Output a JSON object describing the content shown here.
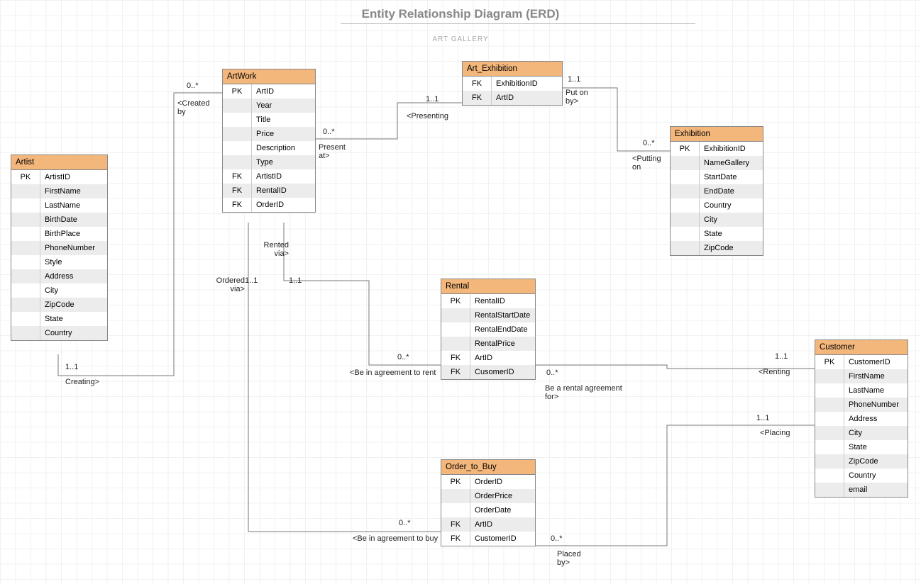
{
  "title": "Entity Relationship Diagram (ERD)",
  "subtitle": "ART GALLERY",
  "entities": {
    "artist": {
      "name": "Artist",
      "rows": [
        {
          "k": "PK",
          "f": "ArtistID"
        },
        {
          "k": "",
          "f": "FirstName"
        },
        {
          "k": "",
          "f": "LastName"
        },
        {
          "k": "",
          "f": "BirthDate"
        },
        {
          "k": "",
          "f": "BirthPlace"
        },
        {
          "k": "",
          "f": "PhoneNumber"
        },
        {
          "k": "",
          "f": "Style"
        },
        {
          "k": "",
          "f": "Address"
        },
        {
          "k": "",
          "f": "City"
        },
        {
          "k": "",
          "f": "ZipCode"
        },
        {
          "k": "",
          "f": "State"
        },
        {
          "k": "",
          "f": "Country"
        }
      ]
    },
    "artwork": {
      "name": "ArtWork",
      "rows": [
        {
          "k": "PK",
          "f": "ArtID"
        },
        {
          "k": "",
          "f": "Year"
        },
        {
          "k": "",
          "f": "Title"
        },
        {
          "k": "",
          "f": "Price"
        },
        {
          "k": "",
          "f": "Description"
        },
        {
          "k": "",
          "f": "Type"
        },
        {
          "k": "FK",
          "f": "ArtistID"
        },
        {
          "k": "FK",
          "f": "RentalID"
        },
        {
          "k": "FK",
          "f": "OrderID"
        }
      ]
    },
    "art_exhibition": {
      "name": "Art_Exhibition",
      "rows": [
        {
          "k": "FK",
          "f": "ExhibitionID"
        },
        {
          "k": "FK",
          "f": "ArtID"
        }
      ]
    },
    "exhibition": {
      "name": "Exhibition",
      "rows": [
        {
          "k": "PK",
          "f": "ExhibitionID"
        },
        {
          "k": "",
          "f": "NameGallery"
        },
        {
          "k": "",
          "f": "StartDate"
        },
        {
          "k": "",
          "f": "EndDate"
        },
        {
          "k": "",
          "f": "Country"
        },
        {
          "k": "",
          "f": "City"
        },
        {
          "k": "",
          "f": "State"
        },
        {
          "k": "",
          "f": "ZipCode"
        }
      ]
    },
    "rental": {
      "name": "Rental",
      "rows": [
        {
          "k": "PK",
          "f": "RentalID"
        },
        {
          "k": "",
          "f": "RentalStartDate"
        },
        {
          "k": "",
          "f": "RentalEndDate"
        },
        {
          "k": "",
          "f": "RentalPrice"
        },
        {
          "k": "FK",
          "f": "ArtID"
        },
        {
          "k": "FK",
          "f": "CusomerID"
        }
      ]
    },
    "order": {
      "name": "Order_to_Buy",
      "rows": [
        {
          "k": "PK",
          "f": "OrderID"
        },
        {
          "k": "",
          "f": "OrderPrice"
        },
        {
          "k": "",
          "f": "OrderDate"
        },
        {
          "k": "FK",
          "f": "ArtID"
        },
        {
          "k": "FK",
          "f": "CustomerID"
        }
      ]
    },
    "customer": {
      "name": "Customer",
      "rows": [
        {
          "k": "PK",
          "f": "CustomerID"
        },
        {
          "k": "",
          "f": "FirstName"
        },
        {
          "k": "",
          "f": "LastName"
        },
        {
          "k": "",
          "f": "PhoneNumber"
        },
        {
          "k": "",
          "f": "Address"
        },
        {
          "k": "",
          "f": "City"
        },
        {
          "k": "",
          "f": "State"
        },
        {
          "k": "",
          "f": "ZipCode"
        },
        {
          "k": "",
          "f": "Country"
        },
        {
          "k": "",
          "f": "email"
        }
      ]
    }
  },
  "labels": {
    "l1a": "0..*",
    "l1b": "<Created by",
    "l1c": "1..1",
    "l1d": "Creating>",
    "l2a": "0..*",
    "l2b": "Present at>",
    "l2c": "1..1",
    "l2d": "<Presenting",
    "l3a": "1..1",
    "l3b": "Put on by>",
    "l3c": "0..*",
    "l3d": "<Putting on",
    "l4a": "1..1",
    "l4b": "Rented via>",
    "l5a": "1..1",
    "l5b": "Ordered via>",
    "l6a": "0..*",
    "l6b": "<Be in agreement to rent",
    "l7a": "0..*",
    "l7b": "Be a rental agreement for>",
    "l7c": "1..1",
    "l7d": "<Renting",
    "l8a": "0..*",
    "l8b": "<Be in agreement to buy",
    "l9a": "0..*",
    "l9b": "Placed by>",
    "l9c": "1..1",
    "l9d": "<Placing"
  }
}
